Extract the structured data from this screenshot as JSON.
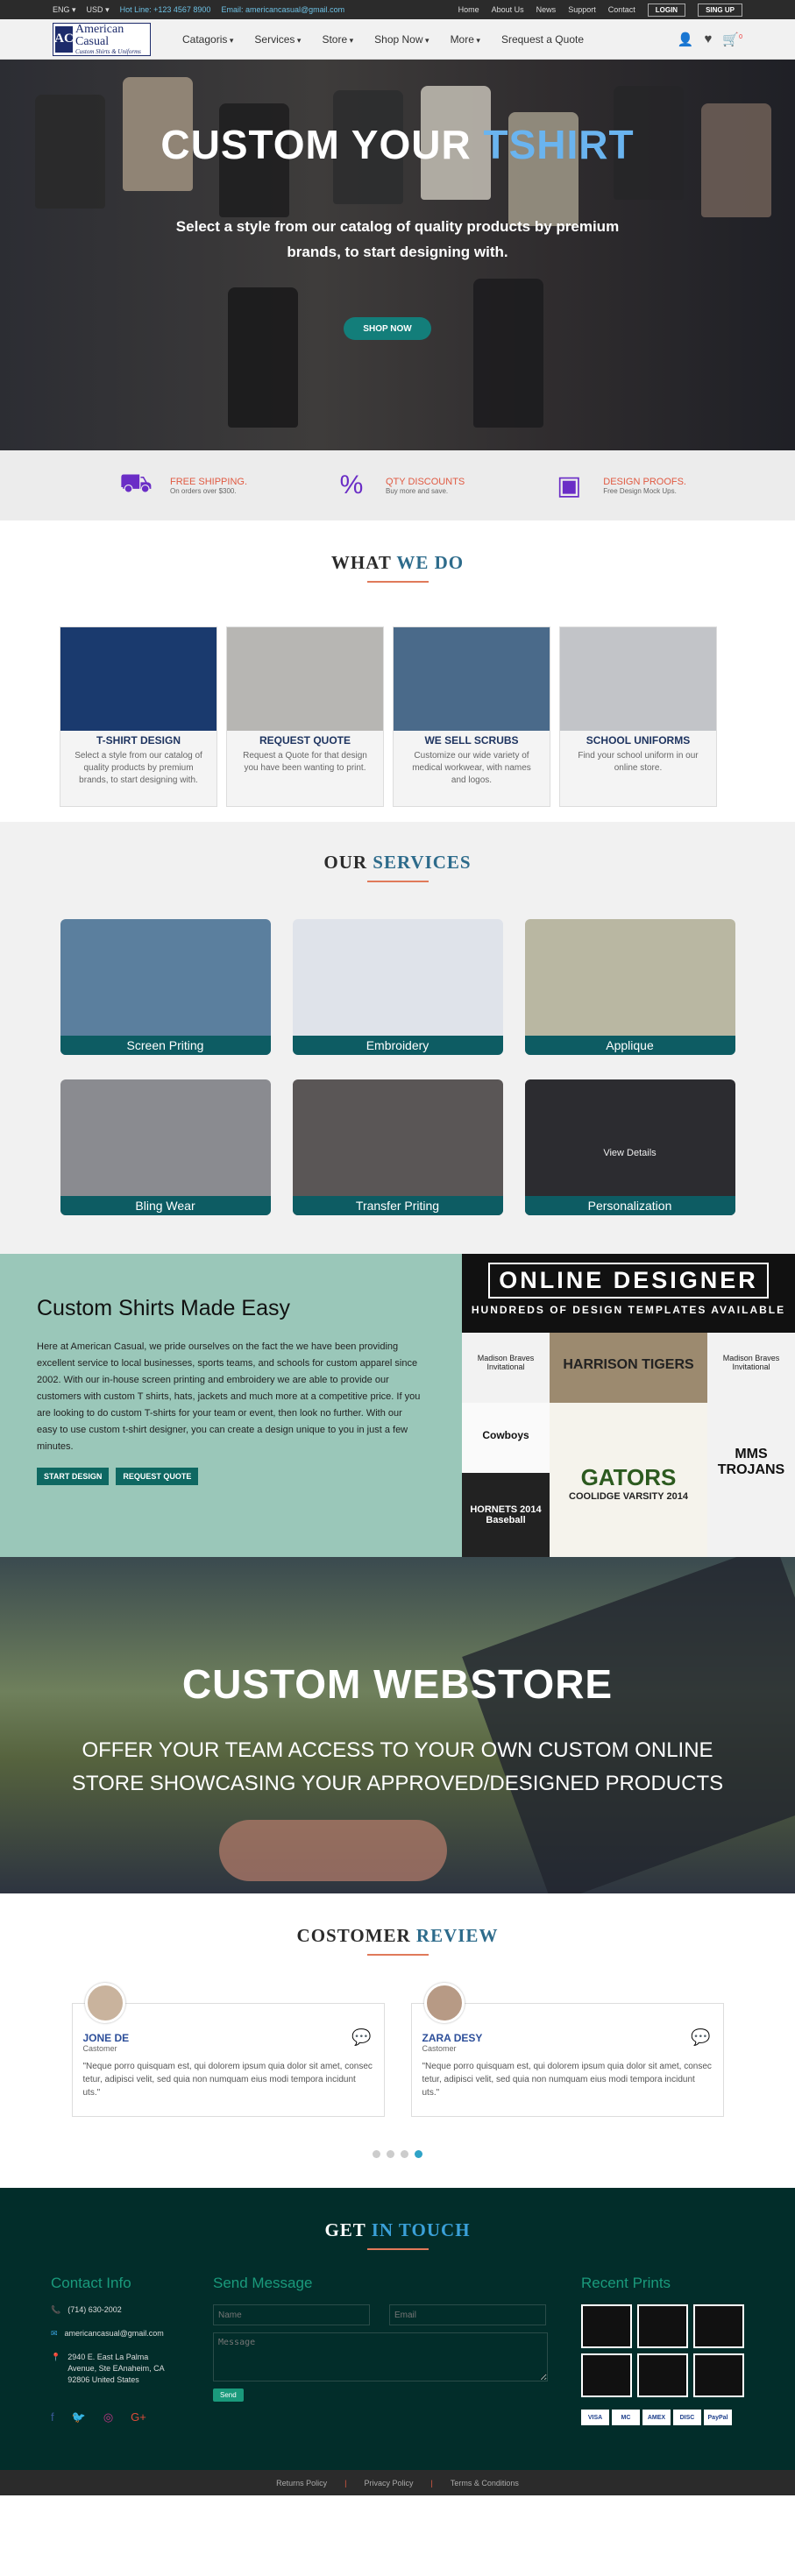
{
  "topbar": {
    "lang": "ENG",
    "currency": "USD",
    "hotline": "Hot Line: +123 4567 8900",
    "email_label": "Email: americancasual@gmail.com",
    "links": [
      "Home",
      "About Us",
      "News",
      "Support",
      "Contact"
    ],
    "login": "LOGIN",
    "signup": "SING UP"
  },
  "logo": {
    "mark": "AC",
    "title": "American Casual",
    "subtitle": "Custom Shirts & Uniforms"
  },
  "menu": [
    "Catagoris",
    "Services",
    "Store",
    "Shop Now",
    "More",
    "Srequest a Quote"
  ],
  "cart_count": "0",
  "hero": {
    "title_a": "CUSTOM YOUR ",
    "title_b": "TSHIRT",
    "text": "Select a style from our catalog of quality products by premium brands, to start designing with.",
    "button": "SHOP NOW"
  },
  "features": [
    {
      "title": "FREE SHIPPING.",
      "sub": "On orders over $300.",
      "icon": "truck-icon"
    },
    {
      "title": "QTY DISCOUNTS",
      "sub": "Buy more and save.",
      "icon": "percent-icon"
    },
    {
      "title": "DESIGN PROOFS.",
      "sub": "Free Design Mock Ups.",
      "icon": "proof-icon"
    }
  ],
  "whatwedo": {
    "t1": "WHAT ",
    "t2": "WE DO",
    "cards": [
      {
        "title": "T-SHIRT DESIGN",
        "text": "Select a style from our catalog of quality products by premium brands, to start designing with.",
        "color": "#1a3a6e"
      },
      {
        "title": "REQUEST QUOTE",
        "text": "Request a Quote for that design you have been wanting to print.",
        "color": "#b7b6b3"
      },
      {
        "title": "WE SELL SCRUBS",
        "text": "Customize our wide variety of medical workwear, with names and logos.",
        "color": "#4a6a8a"
      },
      {
        "title": "SCHOOL UNIFORMS",
        "text": "Find your school uniform in our online store.",
        "color": "#c2c4c8"
      }
    ]
  },
  "services": {
    "t1": "OUR ",
    "t2": "SERVICES",
    "items": [
      "Screen Priting",
      "Embroidery",
      "Applique",
      "Bling Wear",
      "Transfer Priting",
      "Personalization"
    ],
    "view": "View Details",
    "colors": [
      "#5b7f9e",
      "#dfe3ea",
      "#b9b7a2",
      "#8a8b90",
      "#5a5656",
      "#2c2c30"
    ]
  },
  "easy": {
    "title": "Custom Shirts Made Easy",
    "text": "Here at American Casual, we pride ourselves on the fact the we have been providing excellent service to local businesses, sports teams, and schools for custom apparel since 2002. With our in-house screen printing and embroidery we are able to provide our customers with custom T shirts, hats, jackets and much more at a competitive price. If you are looking to do custom T-shirts for your team or event, then look no further. With our easy to use custom t-shirt designer, you can create a design unique to you in just a few minutes.",
    "b1": "START DESIGN",
    "b2": "REQUEST QUOTE",
    "od1": "ONLINE DESIGNER",
    "od2": "HUNDREDS OF DESIGN TEMPLATES AVAILABLE",
    "tiles": [
      "Madison Braves Invitational",
      "HARRISON TIGERS",
      "Madison Braves Invitational",
      "Cowboys",
      "GATORS",
      "MMS TROJANS",
      "HORNETS 2014 Baseball",
      "COOLIDGE VARSITY 2014",
      ""
    ]
  },
  "webstore": {
    "title": "CUSTOM WEBSTORE",
    "text": "OFFER YOUR TEAM ACCESS TO YOUR OWN CUSTOM ONLINE STORE SHOWCASING YOUR APPROVED/DESIGNED PRODUCTS"
  },
  "reviews": {
    "t1": "COSTOMER ",
    "t2": "REVIEW",
    "items": [
      {
        "name": "JONE DE",
        "role": "Castomer",
        "text": "\"Neque porro quisquam est, qui dolorem ipsum quia dolor sit amet, consec tetur, adipisci velit, sed quia non numquam eius modi tempora incidunt uts.\""
      },
      {
        "name": "ZARA DESY",
        "role": "Castomer",
        "text": "\"Neque porro quisquam est, qui dolorem ipsum quia dolor sit amet, consec tetur, adipisci velit, sed quia non numquam eius modi tempora incidunt uts.\""
      }
    ]
  },
  "footer": {
    "t1": "GET ",
    "t2": "IN TOUCH",
    "contact_title": "Contact Info",
    "phone": "(714) 630-2002",
    "email": "americancasual@gmail.com",
    "address": "2940 E. East La Palma Avenue, Ste EAnaheim, CA 92806 United States",
    "send_title": "Send Message",
    "name_ph": "Name",
    "email_ph": "Email",
    "msg_ph": "Message",
    "send": "Send",
    "prints_title": "Recent Prints",
    "pays": [
      "VISA",
      "MC",
      "AMEX",
      "DISC",
      "PayPal"
    ]
  },
  "bottom": [
    "Returns Policy",
    "Privacy Policy",
    "Terms & Conditions"
  ]
}
